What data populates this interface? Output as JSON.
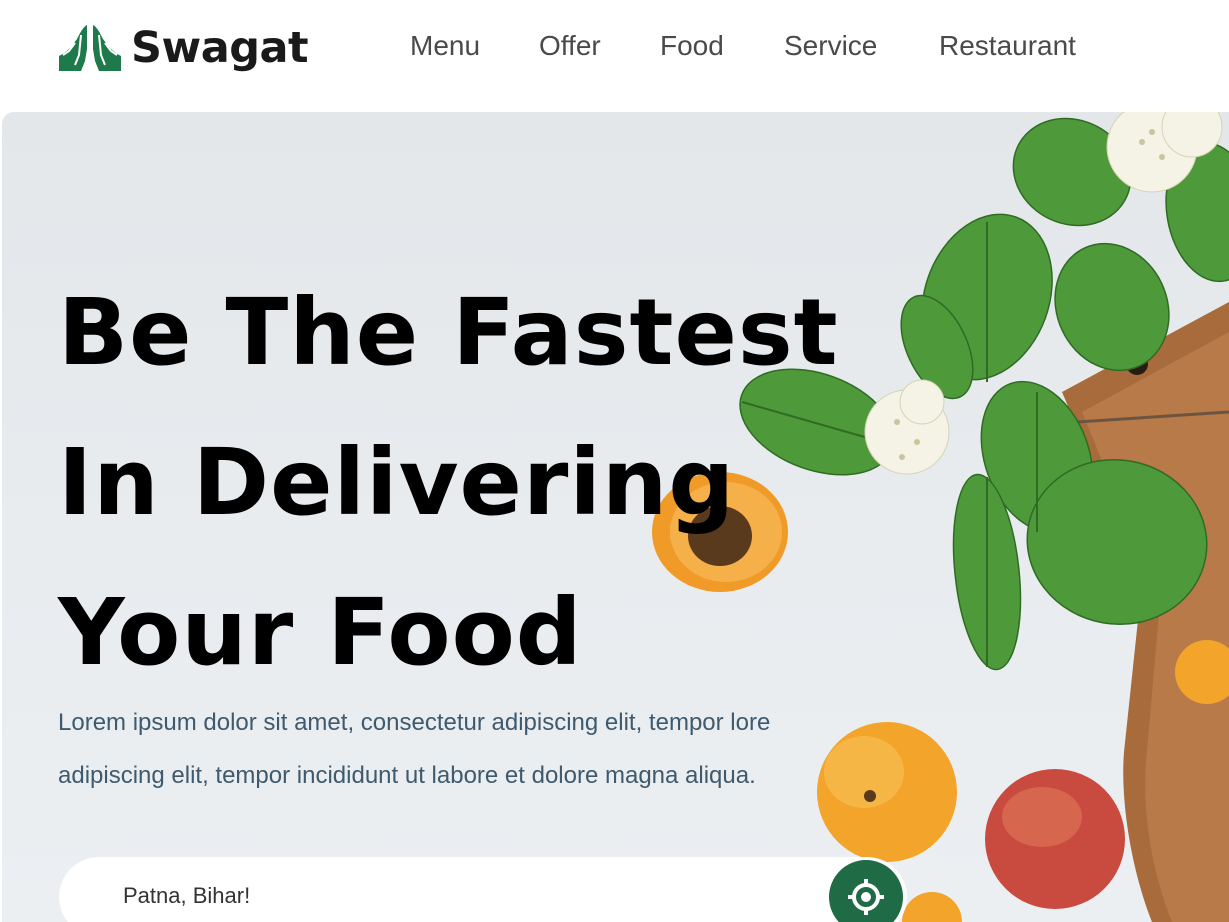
{
  "brand": {
    "name": "Swagat",
    "logo_icon": "praying-hands-icon",
    "logo_color": "#1e7a4a"
  },
  "nav": {
    "items": [
      {
        "label": "Menu"
      },
      {
        "label": "Offer"
      },
      {
        "label": "Food"
      },
      {
        "label": "Service"
      },
      {
        "label": "Restaurant"
      }
    ]
  },
  "hero": {
    "headline_lines": [
      "Be The Fastest",
      "In Delivering",
      "Your Food"
    ],
    "description": "Lorem ipsum dolor sit amet, consectetur adipiscing elit, tempor lore adipiscing elit, tempor incididunt ut labore et dolore magna aliqua.",
    "background_image": "leaves-flowers-apricots-cutting-board"
  },
  "search": {
    "value": "Patna, Bihar!",
    "locate_icon": "crosshair-icon",
    "accent_color": "#1e6b46"
  }
}
